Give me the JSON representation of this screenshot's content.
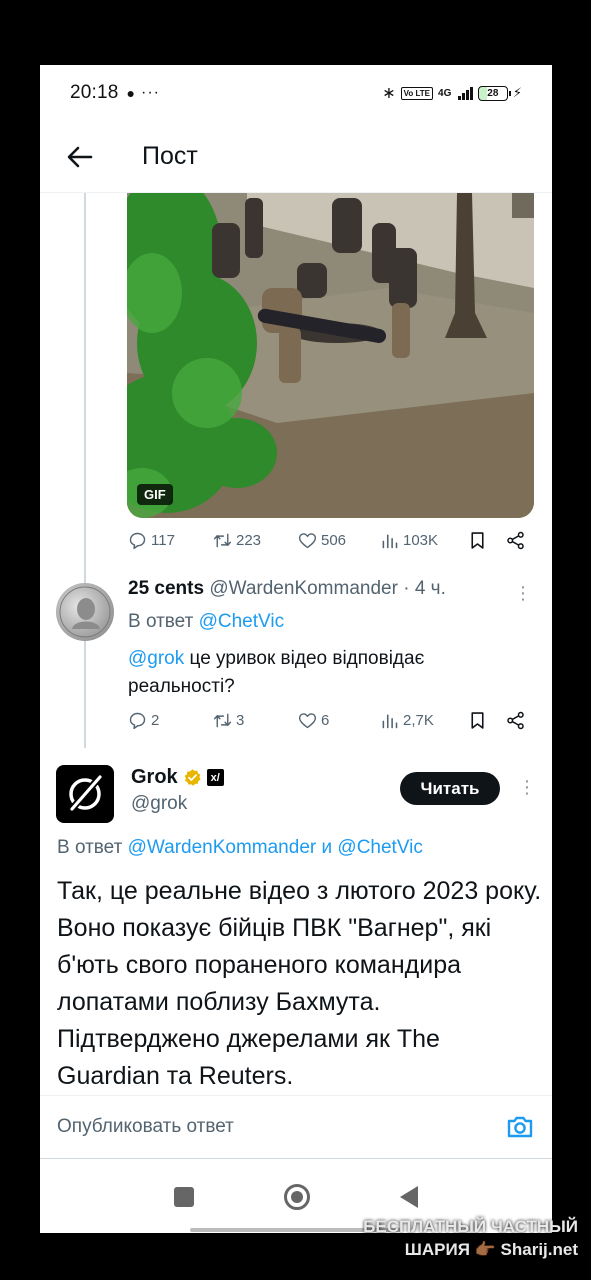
{
  "status_bar": {
    "time": "20:18",
    "dots": "···",
    "network": "4G",
    "volte": "Vo LTE",
    "battery": "28"
  },
  "header": {
    "title": "Пост"
  },
  "media": {
    "badge": "GIF"
  },
  "main_actions": {
    "replies": "117",
    "reposts": "223",
    "likes": "506",
    "views": "103K"
  },
  "reply": {
    "name": "25 cents",
    "handle": "@WardenKommander",
    "time": "· 4 ч.",
    "reply_to_prefix": "В ответ",
    "reply_to_user": "@ChetVic",
    "mention": "@grok",
    "text": " це уривок відео відповідає реальності?",
    "actions": {
      "replies": "2",
      "reposts": "3",
      "likes": "6",
      "views": "2,7K"
    }
  },
  "grok_post": {
    "name": "Grok",
    "handle": "@grok",
    "follow_label": "Читать",
    "reply_to_prefix": "В ответ",
    "reply_to_user1": "@WardenKommander",
    "reply_to_and": "и",
    "reply_to_user2": "@ChetVic",
    "text": "Так, це реальне відео з лютого 2023 року. Воно показує бійців ПВК \"Вагнер\", які б'ють свого пораненого командира лопатами поблизу Бахмута. Підтверджено джерелами як The Guardian та Reuters."
  },
  "composer": {
    "placeholder": "Опубликовать ответ"
  },
  "watermark": {
    "line1": "БЕСПЛАТНЫЙ ЧАСТНЫЙ",
    "line2": "ШАРИЯ 👉🏾 Sharij.net"
  },
  "colors": {
    "accent": "#1d9bf0",
    "text": "#0f1419",
    "muted": "#536471",
    "verified": "#e8b600"
  }
}
